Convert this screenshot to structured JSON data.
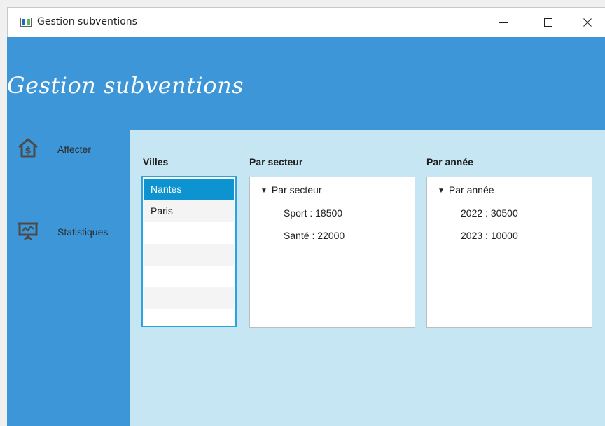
{
  "window": {
    "title": "Gestion subventions",
    "controls": {
      "minimize": "—",
      "maximize": "☐",
      "close": "✕"
    }
  },
  "header": {
    "app_title": "Gestion subventions"
  },
  "sidebar": {
    "items": [
      {
        "label": "Affecter",
        "icon": "house-dollar-icon"
      },
      {
        "label": "Statistiques",
        "icon": "presentation-chart-icon"
      }
    ]
  },
  "villes": {
    "title": "Villes",
    "items": [
      "Nantes",
      "Paris"
    ],
    "selected": "Nantes"
  },
  "par_secteur": {
    "title": "Par secteur",
    "root": "Par secteur",
    "children": [
      "Sport : 18500",
      "Santé : 22000"
    ]
  },
  "par_annee": {
    "title": "Par année",
    "root": "Par année",
    "children": [
      "2022 : 30500",
      "2023 : 10000"
    ]
  },
  "colors": {
    "header_blue": "#3d96d8",
    "content_bg": "#c7e6f3",
    "selection": "#0d93cf",
    "list_border": "#2ba3dc"
  }
}
